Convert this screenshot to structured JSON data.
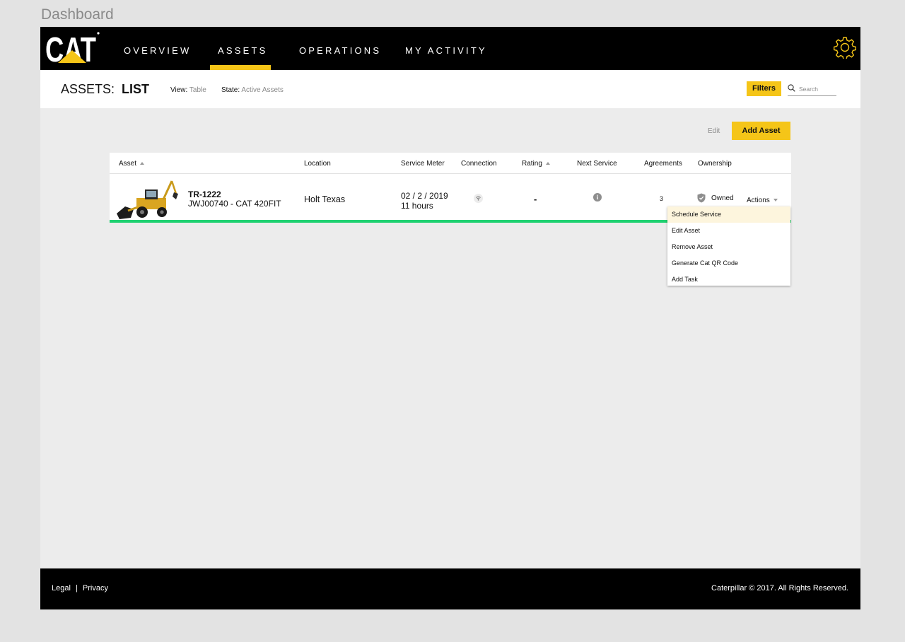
{
  "page_label": "Dashboard",
  "nav": {
    "items": [
      "OVERVIEW",
      "ASSETS",
      "OPERATIONS",
      "MY ACTIVITY"
    ],
    "active": "ASSETS",
    "accent_color": "#f5c518"
  },
  "brand": {
    "logo_text": "CAT"
  },
  "header": {
    "title_prefix": "ASSETS:",
    "title_main": "LIST",
    "view_label": "View:",
    "view_value": "Table",
    "state_label": "State:",
    "state_value": "Active Assets",
    "filters_label": "Filters",
    "search_placeholder": "Search"
  },
  "toolbar": {
    "edit_label": "Edit",
    "add_asset_label": "Add Asset"
  },
  "table": {
    "columns": [
      "Asset",
      "Location",
      "Service Meter",
      "Connection",
      "Rating",
      "Next Service",
      "Agreements",
      "Ownership"
    ],
    "rows": [
      {
        "asset_id": "TR-1222",
        "asset_model": "JWJ00740 - CAT 420FIT",
        "location": "Holt Texas",
        "service_date": "02 / 2 / 2019",
        "service_hours": "11 hours",
        "connection_icon": "wifi-icon",
        "rating": "-",
        "next_service_icon": "info-icon",
        "agreements": "3",
        "ownership": "Owned",
        "actions_label": "Actions",
        "status_color": "#1fd171"
      }
    ]
  },
  "actions_menu": {
    "items": [
      "Schedule Service",
      "Edit Asset",
      "Remove Asset",
      "Generate Cat QR Code",
      "Add Task"
    ],
    "highlighted": "Schedule Service"
  },
  "footer": {
    "legal": "Legal",
    "separator": "|",
    "privacy": "Privacy",
    "copyright": "Caterpillar © 2017. All Rights Reserved."
  }
}
